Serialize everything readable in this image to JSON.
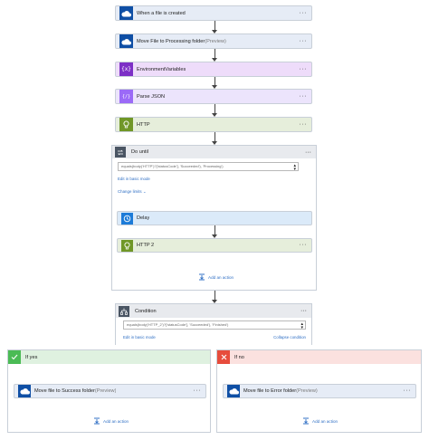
{
  "flow": {
    "trigger": {
      "title": "When a file is created"
    },
    "move_processing": {
      "title": "Move File to Processing folder",
      "preview": "(Preview)"
    },
    "env_vars": {
      "title": "EnvironmentVariables"
    },
    "parse_json": {
      "title": "Parse JSON"
    },
    "http": {
      "title": "HTTP"
    },
    "do_until": {
      "title": "Do until",
      "condition_expr": "equals(body('HTTP')?['statusCode'], 'Succeeded'), 'Processing')",
      "edit_basic": "Edit in basic mode",
      "change_limits": "Change limits",
      "delay": {
        "title": "Delay"
      },
      "http2": {
        "title": "HTTP 2"
      },
      "add_action": "Add an action"
    },
    "condition": {
      "title": "Condition",
      "expr": "equals(body('HTTP_2')?['statusCode'], 'Succeeded'), 'Finished')",
      "edit_basic": "Edit in basic mode",
      "collapse": "Collapse condition"
    },
    "if_yes": {
      "title": "If yes",
      "action": {
        "title": "Move file to Success folder",
        "preview": "(Preview)"
      },
      "add_action": "Add an action"
    },
    "if_no": {
      "title": "If no",
      "action": {
        "title": "Move file to Error folder",
        "preview": "(Preview)"
      },
      "add_action": "Add an action"
    },
    "more_glyph": "···"
  },
  "colors": {
    "onedrive": "#0f4fa5",
    "variables": "#7d2fc6",
    "data_ops": "#9b6af7",
    "http": "#709727",
    "control": "#4a5563",
    "schedule": "#1d7bd8",
    "yes": "#4bbb55",
    "no": "#e74c3c"
  },
  "icons": {
    "onedrive": "cloud-icon",
    "variables": "curly-braces-icon",
    "data_ops": "parse-json-icon",
    "http": "globe-icon",
    "loop": "loop-icon",
    "delay": "timer-icon",
    "condition": "condition-icon",
    "yes": "checkmark-icon",
    "no": "close-icon",
    "add": "add-action-icon"
  }
}
